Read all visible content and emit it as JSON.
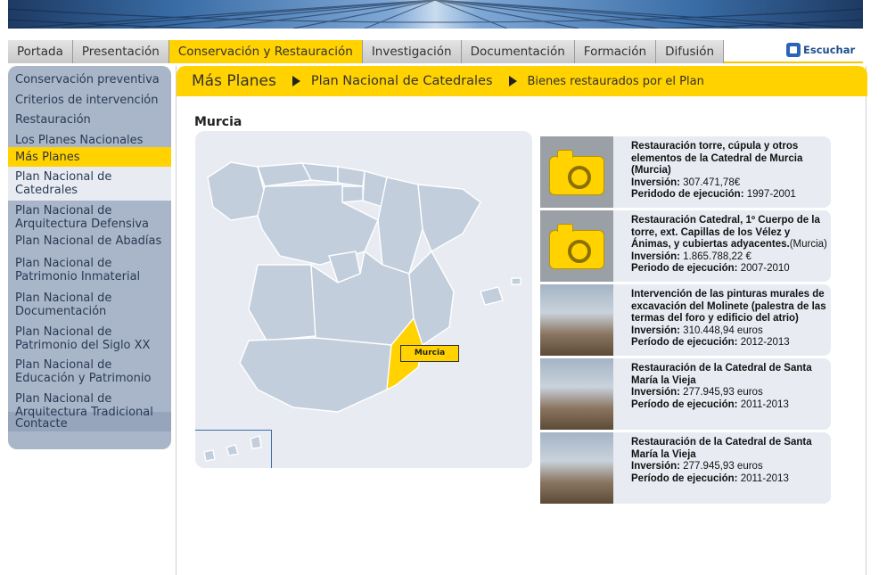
{
  "topnav": {
    "tabs": [
      "Portada",
      "Presentación",
      "Conservación y Restauración",
      "Investigación",
      "Documentación",
      "Formación",
      "Difusión"
    ],
    "active_index": 2,
    "escuchar": "Escuchar"
  },
  "sidebar": {
    "items": [
      "Conservación preventiva",
      "Criterios de intervención",
      "Restauración",
      "Los Planes Nacionales",
      "Más Planes",
      "Plan Nacional de Catedrales",
      "Plan Nacional de Arquitectura Defensiva",
      "Plan Nacional de Abadías",
      "Plan Nacional de Patrimonio Inmaterial",
      "Plan Nacional de Documentación",
      "Plan Nacional de Patrimonio del Siglo XX",
      "Plan Nacional de Educación y Patrimonio",
      "Plan Nacional de Arquitectura Tradicional",
      "Contacte"
    ]
  },
  "breadcrumb": {
    "level1": "Más Planes",
    "level2": "Plan Nacional de Catedrales",
    "level3": "Bienes restaurados por el Plan"
  },
  "region_title": "Murcia",
  "map": {
    "selected_label": "Murcia",
    "highlight_color": "#ffd200"
  },
  "cards": [
    {
      "title": "Restauración torre, cúpula y otros elementos de la Catedral de Murcia (Murcia)",
      "inv_label": "Inversión:",
      "inv_value": "307.471,78€",
      "period_label": "Peridodo de ejecución:",
      "period_value": "1997-2001",
      "thumb": "camera-icon"
    },
    {
      "title": "Restauración Catedral, 1º Cuerpo de la torre, ext. Capillas de los Vélez y Ánimas, y cubiertas adyacentes.",
      "title_suffix": "(Murcia)",
      "inv_label": "Inversión:",
      "inv_value": "1.865.788,22 €",
      "period_label": "Periodo de ejecución:",
      "period_value": "2007-2010",
      "thumb": "camera-icon"
    },
    {
      "title": "Intervención de las pinturas murales de excavación del Molinete (palestra de las termas del foro y edificio del atrio)",
      "inv_label": "Inversión:",
      "inv_value": "310.448,94 euros",
      "period_label": "Período de ejecución:",
      "period_value": "2012-2013",
      "thumb": "photo"
    },
    {
      "title": "Restauración de la Catedral de Santa María la Vieja",
      "inv_label": "Inversión:",
      "inv_value": "277.945,93 euros",
      "period_label": "Período de ejecución:",
      "period_value": "2011-2013",
      "thumb": "photo"
    },
    {
      "title": "Restauración de la Catedral de Santa María la Vieja",
      "inv_label": "Inversión:",
      "inv_value": "277.945,93 euros",
      "period_label": "Período de ejecución:",
      "period_value": "2011-2013",
      "thumb": "photo"
    }
  ]
}
